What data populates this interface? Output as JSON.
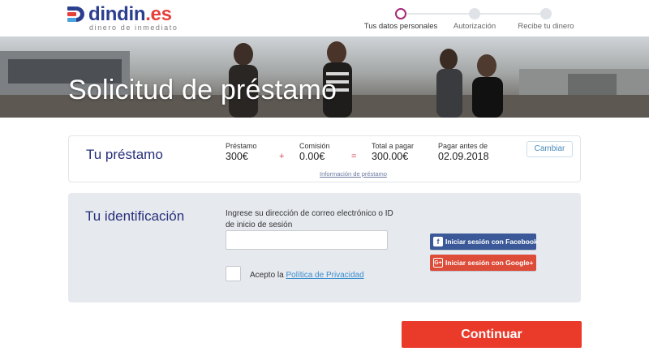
{
  "brand": {
    "name": "dindin",
    "suffix": ".es",
    "tagline": "dinero de inmediato",
    "colors": {
      "primary": "#2c3f8f",
      "accent": "#e5413a",
      "step_active": "#a6287a"
    }
  },
  "steps": [
    {
      "label": "Tus datos personales",
      "state": "active"
    },
    {
      "label": "Autorización",
      "state": "pending"
    },
    {
      "label": "Recibe tu dinero",
      "state": "pending"
    }
  ],
  "hero": {
    "title": "Solicitud de préstamo"
  },
  "loan": {
    "heading": "Tu préstamo",
    "loan_label": "Préstamo",
    "loan_value": "300€",
    "plus": "+",
    "fee_label": "Comisión",
    "fee_value": "0.00€",
    "equals": "=",
    "total_label": "Total a pagar",
    "total_value": "300.00€",
    "due_label": "Pagar antes de",
    "due_value": "02.09.2018",
    "change_label": "Cambiar",
    "info_link": "Información de préstamo"
  },
  "identification": {
    "heading": "Tu identificación",
    "prompt": "Ingrese su dirección de correo electrónico o ID de inicio de sesión",
    "input_value": "",
    "accept_prefix": "Acepto la",
    "privacy_link": "Política de Privacidad",
    "facebook_label": "Iniciar sesión con Facebook",
    "google_label": "Iniciar sesión con Google+",
    "facebook_icon": "facebook-icon",
    "google_icon": "google-plus-icon"
  },
  "continue_label": "Continuar"
}
